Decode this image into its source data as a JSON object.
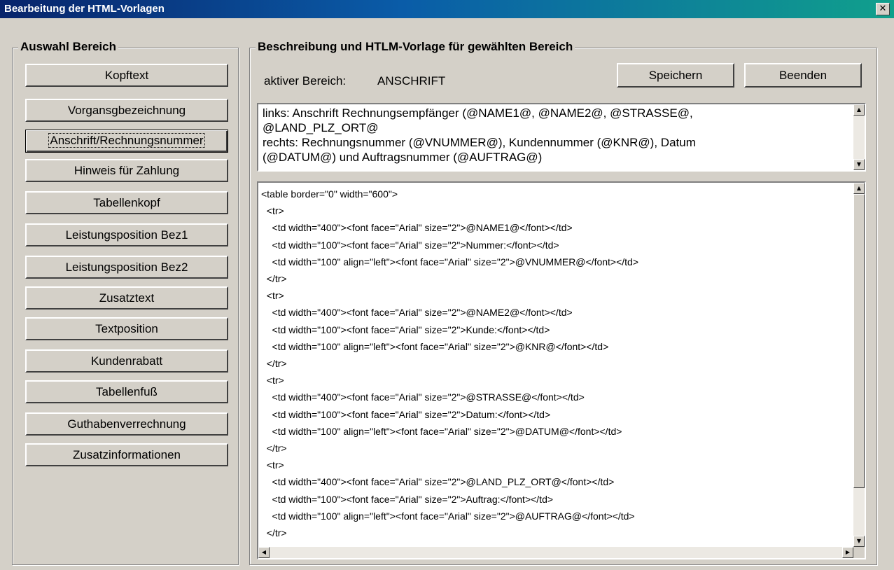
{
  "window": {
    "title": "Bearbeitung der HTML-Vorlagen",
    "close_glyph": "✕"
  },
  "left_group": {
    "legend": "Auswahl Bereich",
    "buttons": [
      "Kopftext",
      "Vorgansgbezeichnung",
      "Anschrift/Rechnungsnummer",
      "Hinweis für Zahlung",
      "Tabellenkopf",
      "Leistungsposition Bez1",
      "Leistungsposition Bez2",
      "Zusatztext",
      "Textposition",
      "Kundenrabatt",
      "Tabellenfuß",
      "Guthabenverrechnung",
      "Zusatzinformationen"
    ],
    "active_index": 2
  },
  "right_group": {
    "legend": "Beschreibung und HTLM-Vorlage für gewählten Bereich",
    "active_label": "aktiver Bereich:",
    "active_value": "ANSCHRIFT",
    "save_label": "Speichern",
    "close_label": "Beenden",
    "description": "links: Anschrift Rechnungsempfänger (@NAME1@, @NAME2@, @STRASSE@,\n@LAND_PLZ_ORT@\nrechts: Rechnungsnummer (@VNUMMER@), Kundennummer (@KNR@), Datum\n(@DATUM@) und Auftragsnummer (@AUFTRAG@)",
    "template_code": "<table border=\"0\" width=\"600\">\n  <tr>\n    <td width=\"400\"><font face=\"Arial\" size=\"2\">@NAME1@</font></td>\n    <td width=\"100\"><font face=\"Arial\" size=\"2\">Nummer:</font></td>\n    <td width=\"100\" align=\"left\"><font face=\"Arial\" size=\"2\">@VNUMMER@</font></td>\n  </tr>\n  <tr>\n    <td width=\"400\"><font face=\"Arial\" size=\"2\">@NAME2@</font></td>\n    <td width=\"100\"><font face=\"Arial\" size=\"2\">Kunde:</font></td>\n    <td width=\"100\" align=\"left\"><font face=\"Arial\" size=\"2\">@KNR@</font></td>\n  </tr>\n  <tr>\n    <td width=\"400\"><font face=\"Arial\" size=\"2\">@STRASSE@</font></td>\n    <td width=\"100\"><font face=\"Arial\" size=\"2\">Datum:</font></td>\n    <td width=\"100\" align=\"left\"><font face=\"Arial\" size=\"2\">@DATUM@</font></td>\n  </tr>\n  <tr>\n    <td width=\"400\"><font face=\"Arial\" size=\"2\">@LAND_PLZ_ORT@</font></td>\n    <td width=\"100\"><font face=\"Arial\" size=\"2\">Auftrag:</font></td>\n    <td width=\"100\" align=\"left\"><font face=\"Arial\" size=\"2\">@AUFTRAG@</font></td>\n  </tr>"
  },
  "icons": {
    "scroll_up": "▲",
    "scroll_down": "▼",
    "scroll_left": "◀",
    "scroll_right": "▶"
  }
}
